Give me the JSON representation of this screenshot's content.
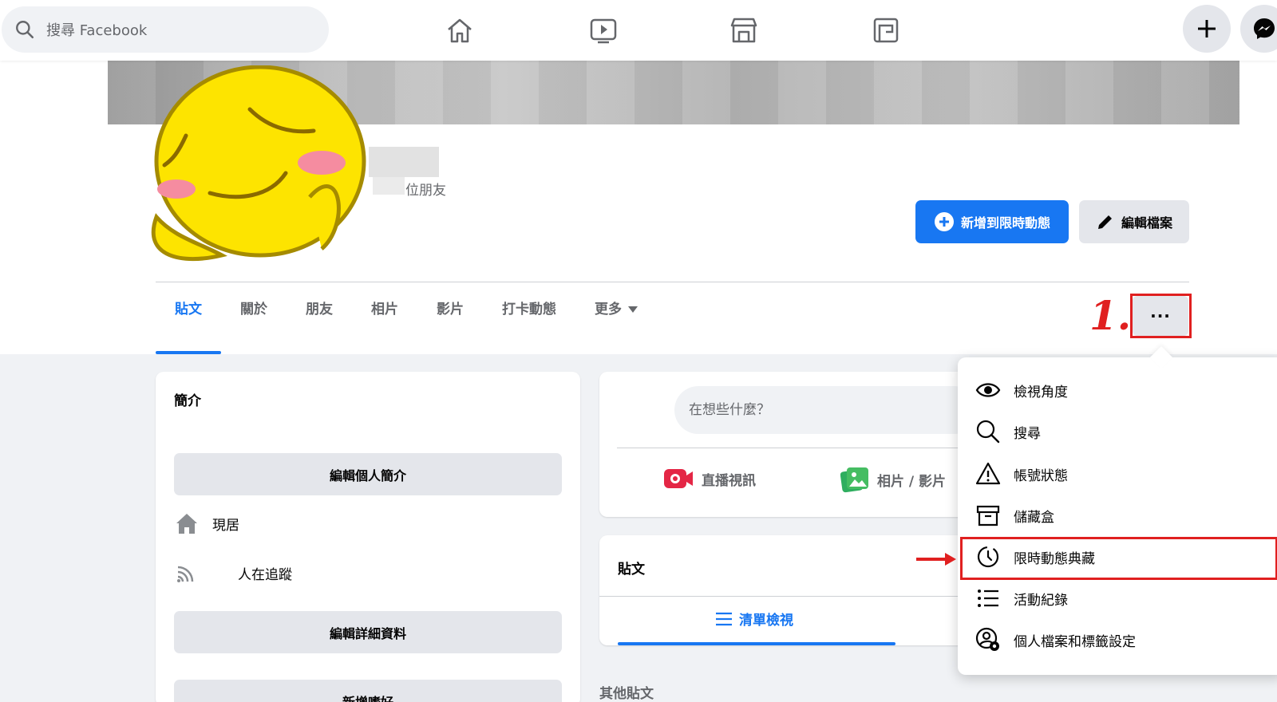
{
  "topbar": {
    "search_placeholder": "搜尋 Facebook",
    "nav": [
      "home-icon",
      "watch-icon",
      "marketplace-icon",
      "gaming-icon"
    ],
    "create": "plus-icon",
    "messenger": "messenger-icon"
  },
  "profile": {
    "friends_count_label": "位朋友",
    "add_story": "新增到限時動態",
    "edit_profile": "編輯檔案",
    "annotation_number": "1.",
    "more_button": "···"
  },
  "tabs": [
    {
      "label": "貼文",
      "active": true
    },
    {
      "label": "關於"
    },
    {
      "label": "朋友"
    },
    {
      "label": "相片"
    },
    {
      "label": "影片"
    },
    {
      "label": "打卡動態"
    },
    {
      "label": "更多"
    }
  ],
  "intro": {
    "title": "簡介",
    "edit_bio": "編輯個人簡介",
    "current_city": "現居",
    "followers": "人在追蹤",
    "edit_details": "編輯詳細資料",
    "add_hobbies": "新增嗜好"
  },
  "composer": {
    "placeholder": "在想些什麼？",
    "live_video": "直播視訊",
    "photo_video": "相片 / 影片"
  },
  "posts": {
    "title": "貼文",
    "list_view": "清單檢視",
    "other_posts": "其他貼文"
  },
  "menu": {
    "items": [
      {
        "label": "檢視角度",
        "icon": "eye-icon"
      },
      {
        "label": "搜尋",
        "icon": "search-icon"
      },
      {
        "label": "帳號狀態",
        "icon": "warning-icon"
      },
      {
        "label": "儲藏盒",
        "icon": "archive-box-icon"
      },
      {
        "label": "限時動態典藏",
        "icon": "story-archive-icon",
        "highlighted": true
      },
      {
        "label": "活動紀錄",
        "icon": "list-icon"
      },
      {
        "label": "個人檔案和標籤設定",
        "icon": "profile-settings-icon"
      }
    ]
  },
  "colors": {
    "accent": "#1877f2",
    "annotation": "#e02020",
    "background": "#f0f2f5"
  }
}
